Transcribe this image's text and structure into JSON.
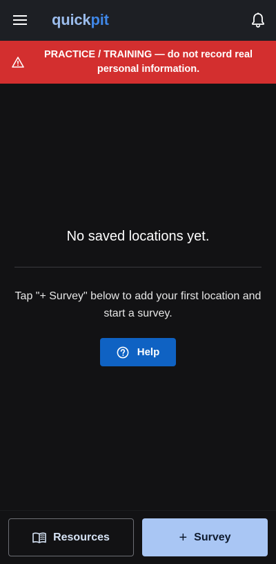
{
  "header": {
    "brand_part1": "quick",
    "brand_part2": "pit",
    "menu_icon": "hamburger-menu-icon",
    "notification_icon": "bell-icon"
  },
  "banner": {
    "icon": "warning-triangle-icon",
    "text": "PRACTICE / TRAINING — do not record real personal information.",
    "background_color": "#d32f2f"
  },
  "empty_state": {
    "title": "No saved locations yet.",
    "subtitle": "Tap \"+ Survey\" below to add your first location and start a survey.",
    "help_label": "Help",
    "help_icon": "question-circle-icon"
  },
  "bottom_bar": {
    "resources_label": "Resources",
    "resources_icon": "book-icon",
    "survey_plus": "+",
    "survey_label": "Survey"
  },
  "colors": {
    "background": "#121214",
    "app_bar": "#1d1f24",
    "accent": "#0f62c3",
    "survey_button": "#a9c6f4"
  }
}
